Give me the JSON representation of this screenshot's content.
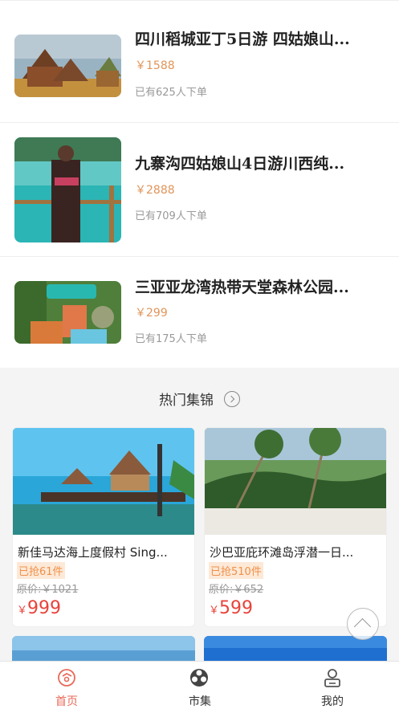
{
  "top_list": [
    {
      "title": "四川稻城亚丁5日游 四姑娘山...",
      "price": "￥1588",
      "sold": "已有625人下单"
    },
    {
      "title": "九寨沟四姑娘山4日游川西纯...",
      "price": "￥2888",
      "sold": "已有709人下单"
    },
    {
      "title": "三亚亚龙湾热带天堂森林公园...",
      "price": "￥299",
      "sold": "已有175人下单"
    }
  ],
  "section": {
    "title": "热门集锦"
  },
  "cards": [
    {
      "name": "新佳马达海上度假村 Sing...",
      "grabbed": "已抢61件",
      "orig": "原价:￥1021",
      "currency": "￥",
      "price": "999"
    },
    {
      "name": "沙巴亚庇环滩岛浮潜一日...",
      "grabbed": "已抢510件",
      "orig": "原价:￥652",
      "currency": "￥",
      "price": "599"
    }
  ],
  "tabs": [
    {
      "label": "首页",
      "icon": "home-icon",
      "active": true
    },
    {
      "label": "市集",
      "icon": "market-icon",
      "active": false
    },
    {
      "label": "我的",
      "icon": "profile-icon",
      "active": false
    }
  ],
  "colors": {
    "price_orange": "#e0955a",
    "sale_red": "#e8433a",
    "tab_active": "#e86a5a"
  }
}
